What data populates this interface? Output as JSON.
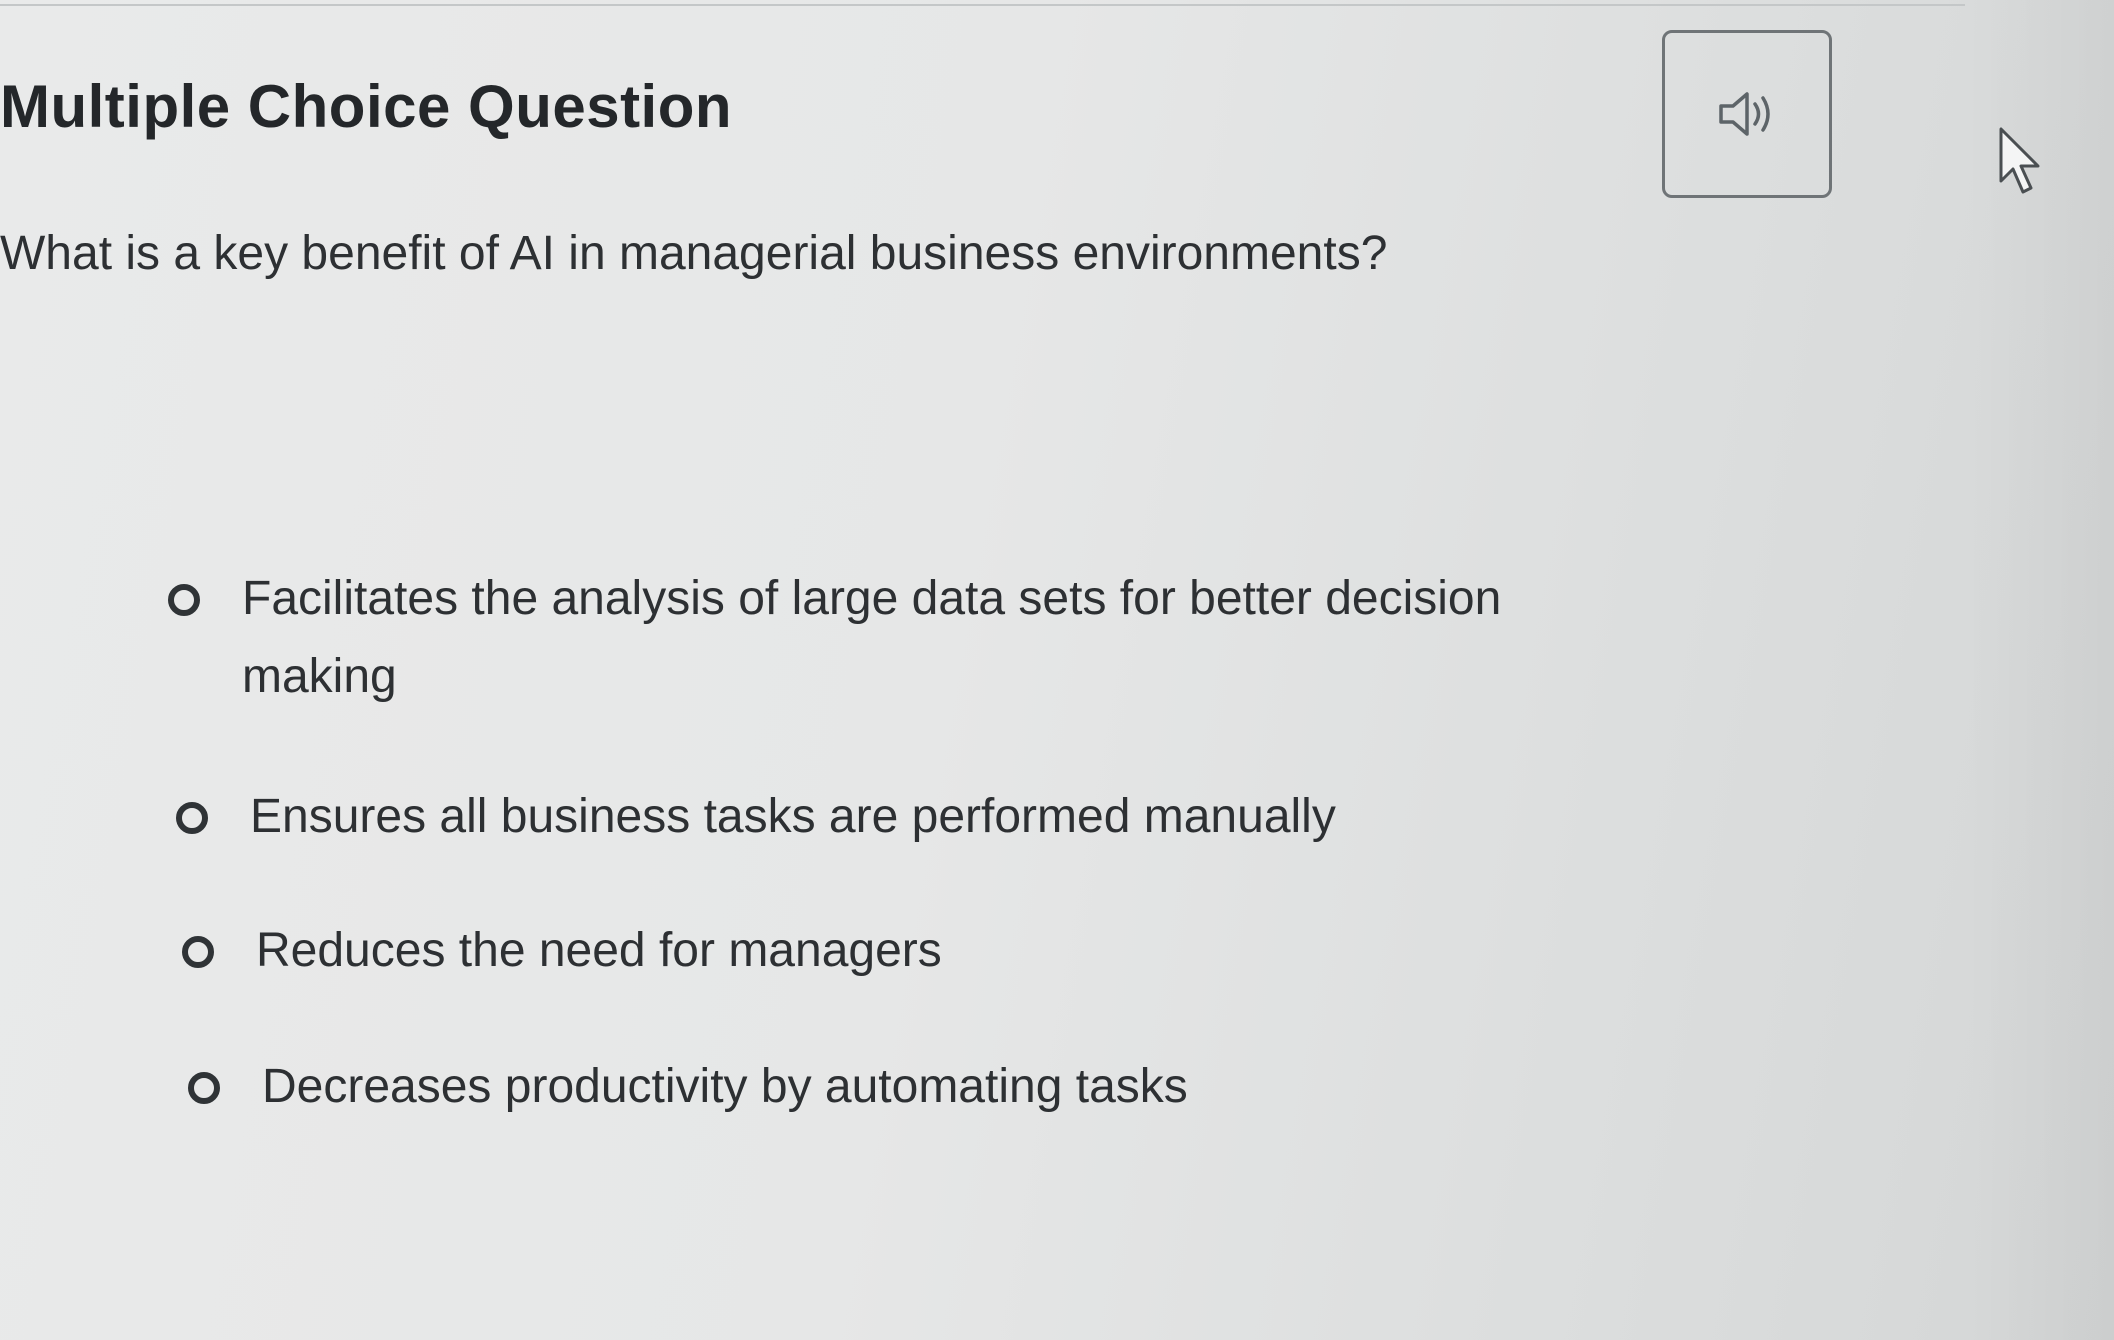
{
  "header": {
    "question_type": "Multiple Choice Question",
    "audio_icon": "speaker-icon"
  },
  "question": {
    "text": "What is a key benefit of AI in managerial business environments?"
  },
  "options": [
    {
      "label": "Facilitates the analysis of large data sets for better decision making",
      "selected": false
    },
    {
      "label": "Ensures all business tasks are performed manually",
      "selected": false
    },
    {
      "label": "Reduces the need for managers",
      "selected": false
    },
    {
      "label": "Decreases productivity by automating tasks",
      "selected": false
    }
  ],
  "icons": {
    "cursor": "mouse-pointer-icon",
    "option_marker": "radio-button-icon"
  },
  "colors": {
    "text": "#2d3033",
    "border": "#6f7477"
  }
}
